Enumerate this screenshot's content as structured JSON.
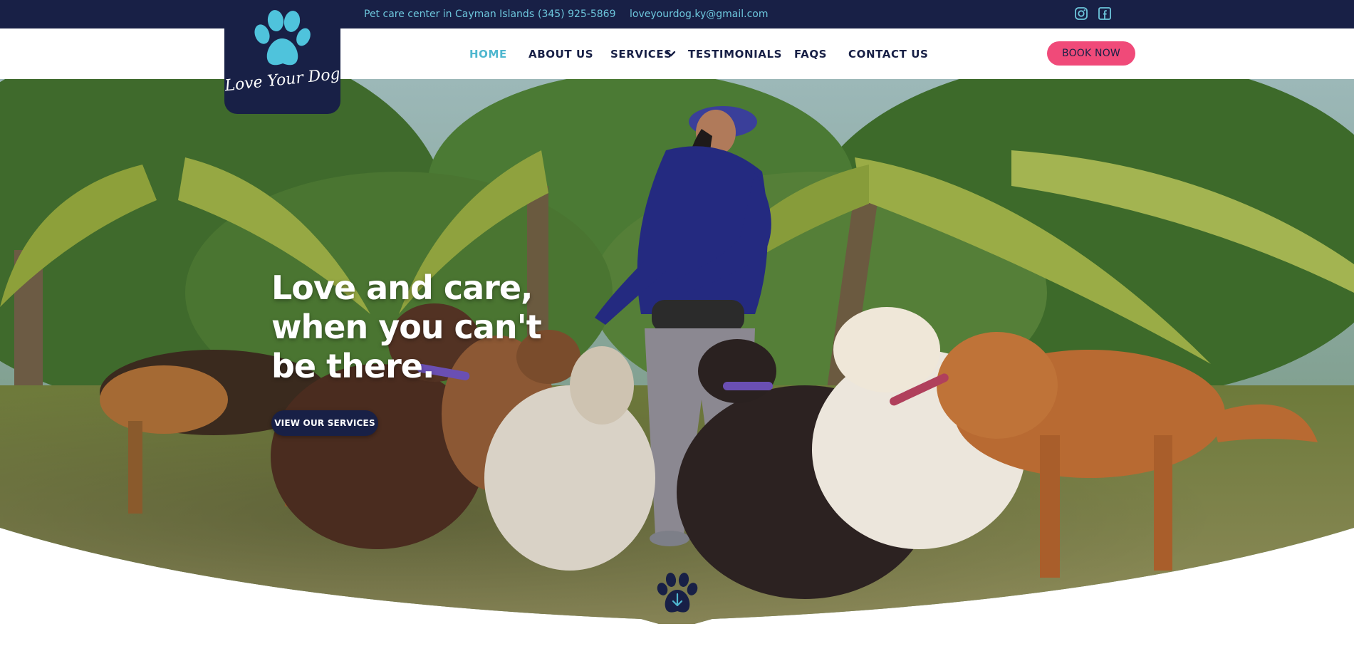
{
  "topbar": {
    "location": "Pet care center in Cayman Islands",
    "phone": "(345) 925-5869",
    "email": "loveyourdog.ky@gmail.com",
    "social": [
      {
        "icon": "instagram-icon"
      },
      {
        "icon": "facebook-icon"
      }
    ]
  },
  "logo": {
    "text": "Love Your Dog",
    "icon": "paw-icon"
  },
  "nav": {
    "items": [
      {
        "label": "HOME",
        "active": true
      },
      {
        "label": "ABOUT US",
        "active": false
      },
      {
        "label": "SERVICES",
        "active": false,
        "dropdown": true
      },
      {
        "label": "TESTIMONIALS",
        "active": false
      },
      {
        "label": "FAQS",
        "active": false
      },
      {
        "label": "CONTACT US",
        "active": false
      }
    ],
    "book_label": "BOOK NOW"
  },
  "hero": {
    "headline_line1": "Love and care,",
    "headline_line2": "when you can't",
    "headline_line3": "be there.",
    "cta_label": "VIEW OUR SERVICES",
    "scroll_icon": "paw-arrow-down-icon"
  },
  "colors": {
    "navy": "#182046",
    "teal": "#4fb7cf",
    "pink": "#f04a79",
    "white": "#ffffff"
  }
}
